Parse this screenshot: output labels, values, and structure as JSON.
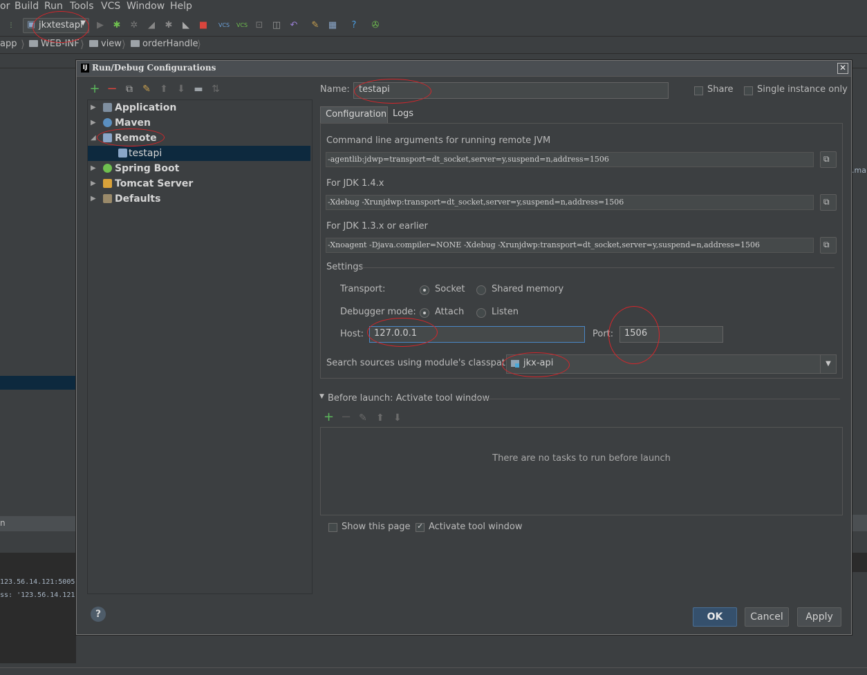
{
  "menu": [
    "or",
    "Build",
    "Run",
    "Tools",
    "VCS",
    "Window",
    "Help"
  ],
  "toolbar": {
    "run_config": "jkxtestapi"
  },
  "breadcrumbs": [
    "app",
    "WEB-INF",
    "view",
    "orderHandle"
  ],
  "console": {
    "line1": "123.56.14.121:5005'",
    "line2": "ss: '123.56.14.121:"
  },
  "right_strip_text": ".ma",
  "bottom_strip_text": "n",
  "dialog": {
    "title": "Run/Debug Configurations",
    "tree": {
      "application": "Application",
      "maven": "Maven",
      "remote": "Remote",
      "testapi": "testapi",
      "spring_boot": "Spring Boot",
      "tomcat": "Tomcat Server",
      "defaults": "Defaults"
    },
    "name_label": "Name:",
    "name_value": "testapi",
    "share_label": "Share",
    "single_instance_label": "Single instance only",
    "tabs": {
      "configuration": "Configuration",
      "logs": "Logs"
    },
    "cmd_label": "Command line arguments for running remote JVM",
    "cmd_value": "-agentlib:jdwp=transport=dt_socket,server=y,suspend=n,address=1506",
    "jdk14_label": "For JDK 1.4.x",
    "jdk14_value": "-Xdebug -Xrunjdwp:transport=dt_socket,server=y,suspend=n,address=1506",
    "jdk13_label": "For JDK 1.3.x or earlier",
    "jdk13_value": "-Xnoagent -Djava.compiler=NONE -Xdebug -Xrunjdwp:transport=dt_socket,server=y,suspend=n,address=1506",
    "settings_label": "Settings",
    "transport_label": "Transport:",
    "socket_label": "Socket",
    "shared_memory_label": "Shared memory",
    "debugger_mode_label": "Debugger mode:",
    "attach_label": "Attach",
    "listen_label": "Listen",
    "host_label": "Host:",
    "host_value": "127.0.0.1",
    "port_label": "Port:",
    "port_value": "1506",
    "classpath_label": "Search sources using module's classpath:",
    "module_value": "jkx-api",
    "before_launch_label": "Before launch: Activate tool window",
    "no_tasks_text": "There are no tasks to run before launch",
    "show_page_label": "Show this page",
    "activate_tool_label": "Activate tool window",
    "ok_label": "OK",
    "cancel_label": "Cancel",
    "apply_label": "Apply"
  },
  "colors": {
    "annotation": "#d6262b",
    "selection": "#0d293e",
    "background": "#3c3f41"
  }
}
